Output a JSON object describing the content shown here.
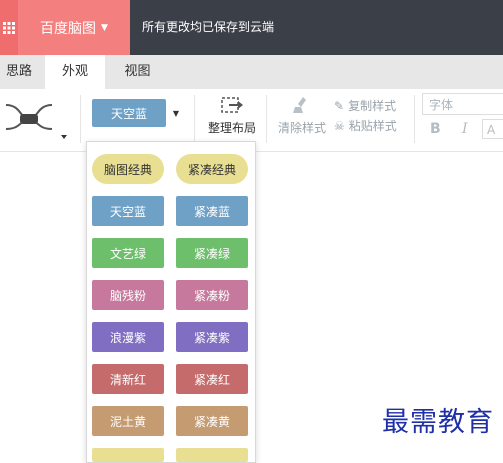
{
  "app": {
    "title": "百度脑图",
    "save_status": "所有更改均已保存到云端"
  },
  "tabs": [
    {
      "label": "思路"
    },
    {
      "label": "外观",
      "active": true
    },
    {
      "label": "视图"
    }
  ],
  "toolbar": {
    "current_theme": "天空蓝",
    "layout_label": "整理布局",
    "clear_style_label": "清除样式",
    "copy_style_label": "复制样式",
    "paste_style_label": "粘贴样式",
    "font_placeholder": "字体",
    "bold_label": "B",
    "italic_label": "I",
    "font_color_label": "A"
  },
  "themes": [
    {
      "label": "脑图经典",
      "color": "#e9df93"
    },
    {
      "label": "紧凑经典",
      "color": "#e9df93"
    },
    {
      "label": "天空蓝",
      "color": "#6fa1c7"
    },
    {
      "label": "紧凑蓝",
      "color": "#6fa1c7"
    },
    {
      "label": "文艺绿",
      "color": "#6dbf6c"
    },
    {
      "label": "紧凑绿",
      "color": "#6dbf6c"
    },
    {
      "label": "脑残粉",
      "color": "#c6799d"
    },
    {
      "label": "紧凑粉",
      "color": "#c6799d"
    },
    {
      "label": "浪漫紫",
      "color": "#7f6ec2"
    },
    {
      "label": "紧凑紫",
      "color": "#7f6ec2"
    },
    {
      "label": "清新红",
      "color": "#c56b6b"
    },
    {
      "label": "紧凑红",
      "color": "#c56b6b"
    },
    {
      "label": "泥土黄",
      "color": "#c59b72"
    },
    {
      "label": "紧凑黄",
      "color": "#c59b72"
    }
  ],
  "watermark": "最需教育",
  "colors": {
    "topbar": "#3b3f47",
    "app_button": "#f37f7f",
    "tabbar": "#e7e7e7"
  }
}
